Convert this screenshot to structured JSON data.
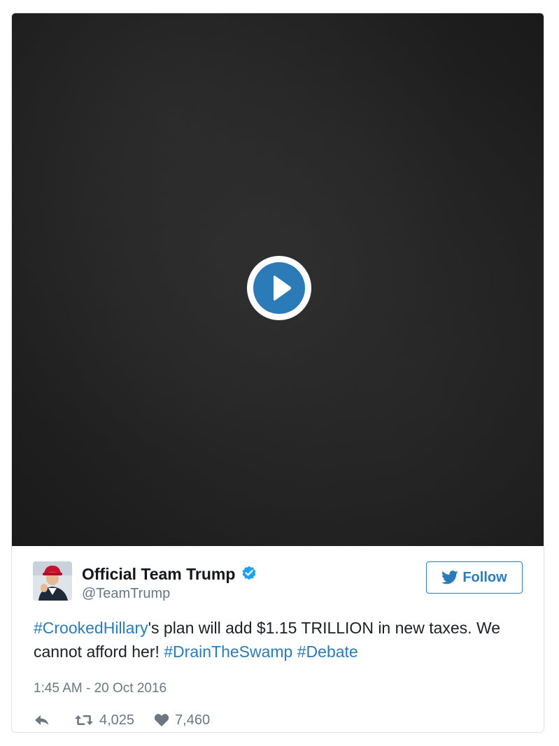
{
  "author": {
    "display_name": "Official Team Trump",
    "handle": "@TeamTrump",
    "verified": true,
    "verified_icon": "verified-badge-icon",
    "follow_label": "Follow",
    "follow_icon": "twitter-bird-icon"
  },
  "tweet": {
    "segments": [
      {
        "text": "#CrookedHillary",
        "link": true
      },
      {
        "text": "'s plan will add $1.15 TRILLION in new taxes. We cannot afford her! ",
        "link": false
      },
      {
        "text": "#DrainTheSwamp",
        "link": true
      },
      {
        "text": " ",
        "link": false
      },
      {
        "text": "#Debate",
        "link": true
      }
    ],
    "timestamp": "1:45 AM - 20 Oct 2016"
  },
  "media": {
    "type": "video",
    "play_icon": "play-icon"
  },
  "actions": {
    "reply_icon": "reply-icon",
    "retweet_icon": "retweet-icon",
    "retweet_count": "4,025",
    "like_icon": "heart-icon",
    "like_count": "7,460"
  },
  "colors": {
    "link": "#2b7bb9",
    "verified": "#1da1f2",
    "play_button": "#2b7bb9",
    "text": "#1c2022",
    "muted": "#697882"
  }
}
